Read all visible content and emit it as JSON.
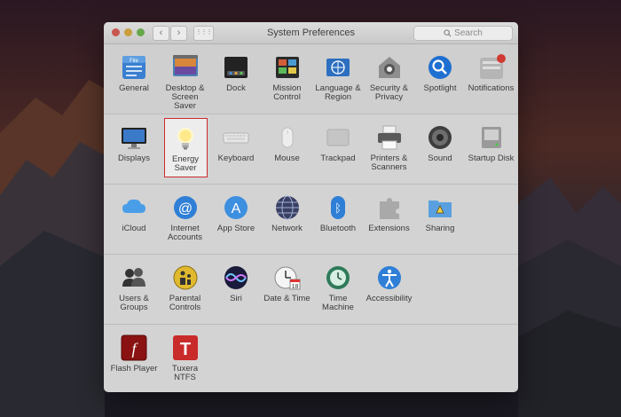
{
  "window": {
    "title": "System Preferences",
    "search_placeholder": "Search",
    "back_glyph": "‹",
    "forward_glyph": "›",
    "grid_glyph": "⋮⋮⋮"
  },
  "sections": [
    {
      "items": [
        {
          "label": "General",
          "icon": "general-icon"
        },
        {
          "label": "Desktop & Screen Saver",
          "icon": "desktop-icon"
        },
        {
          "label": "Dock",
          "icon": "dock-icon"
        },
        {
          "label": "Mission Control",
          "icon": "mission-control-icon"
        },
        {
          "label": "Language & Region",
          "icon": "language-region-icon"
        },
        {
          "label": "Security & Privacy",
          "icon": "security-icon"
        },
        {
          "label": "Spotlight",
          "icon": "spotlight-icon"
        },
        {
          "label": "Notifications",
          "icon": "notifications-icon"
        }
      ]
    },
    {
      "items": [
        {
          "label": "Displays",
          "icon": "displays-icon"
        },
        {
          "label": "Energy Saver",
          "icon": "energy-saver-icon",
          "highlighted": true
        },
        {
          "label": "Keyboard",
          "icon": "keyboard-icon"
        },
        {
          "label": "Mouse",
          "icon": "mouse-icon"
        },
        {
          "label": "Trackpad",
          "icon": "trackpad-icon"
        },
        {
          "label": "Printers & Scanners",
          "icon": "printer-icon"
        },
        {
          "label": "Sound",
          "icon": "sound-icon"
        },
        {
          "label": "Startup Disk",
          "icon": "startup-disk-icon"
        }
      ]
    },
    {
      "items": [
        {
          "label": "iCloud",
          "icon": "icloud-icon"
        },
        {
          "label": "Internet Accounts",
          "icon": "internet-accounts-icon"
        },
        {
          "label": "App Store",
          "icon": "app-store-icon"
        },
        {
          "label": "Network",
          "icon": "network-icon"
        },
        {
          "label": "Bluetooth",
          "icon": "bluetooth-icon"
        },
        {
          "label": "Extensions",
          "icon": "extensions-icon"
        },
        {
          "label": "Sharing",
          "icon": "sharing-icon"
        }
      ]
    },
    {
      "items": [
        {
          "label": "Users & Groups",
          "icon": "users-icon"
        },
        {
          "label": "Parental Controls",
          "icon": "parental-controls-icon"
        },
        {
          "label": "Siri",
          "icon": "siri-icon"
        },
        {
          "label": "Date & Time",
          "icon": "date-time-icon"
        },
        {
          "label": "Time Machine",
          "icon": "time-machine-icon"
        },
        {
          "label": "Accessibility",
          "icon": "accessibility-icon"
        }
      ]
    },
    {
      "items": [
        {
          "label": "Flash Player",
          "icon": "flash-player-icon"
        },
        {
          "label": "Tuxera NTFS",
          "icon": "tuxera-icon"
        }
      ]
    }
  ],
  "icon_texts": {
    "general_file": "File",
    "date_day": "18",
    "tuxera_letter": "T",
    "flash_letter": "f",
    "bluetooth_glyph": "ᛒ",
    "appstore_letter": "A",
    "internet_glyph": "@"
  },
  "colors": {
    "highlight_border": "#cc2a2a",
    "notification_badge": "#d03a32"
  }
}
